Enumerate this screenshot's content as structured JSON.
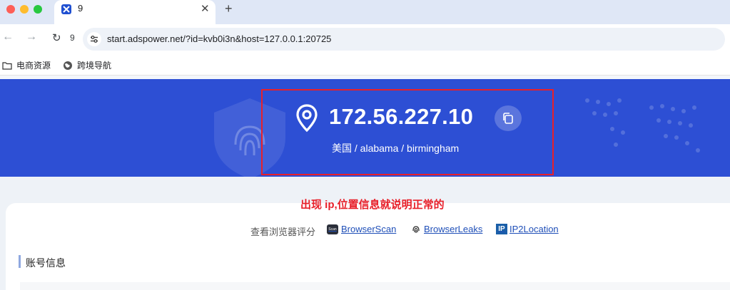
{
  "browser": {
    "tab": {
      "title": "9",
      "favicon": "adspower-logo-icon"
    },
    "toolbar": {
      "reload_count": "9"
    },
    "url": "start.adspower.net/?id=kvb0i3n&host=127.0.0.1:20725",
    "bookmarks": [
      {
        "label": "电商资源",
        "icon": "folder-icon"
      },
      {
        "label": "跨境导航",
        "icon": "globe-icon"
      }
    ]
  },
  "hero": {
    "ip": "172.56.227.10",
    "location": "美国 / alabama / birmingham",
    "highlight_color": "#e8202a",
    "background_color": "#2d4fd4"
  },
  "main": {
    "notice": "出现 ip,位置信息就说明正常的",
    "score_label": "查看浏览器评分",
    "links": [
      {
        "label": "BrowserScan",
        "badge": "Scan"
      },
      {
        "label": "BrowserLeaks",
        "icon": "fingerprint-icon"
      },
      {
        "label": "IP2Location",
        "badge": "IP"
      }
    ],
    "section_title": "账号信息"
  }
}
